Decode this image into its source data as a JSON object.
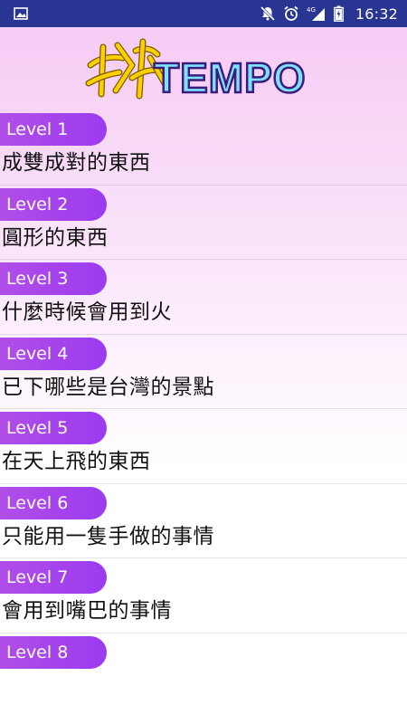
{
  "status_bar": {
    "time": "16:32",
    "network": "4G",
    "icons": [
      "image-icon",
      "mute-icon",
      "alarm-icon",
      "signal-icon",
      "battery-icon"
    ]
  },
  "header": {
    "logo_text": "TEMPO",
    "logo_colors": {
      "text_fill": "#7fe0ff",
      "text_stroke": "#3a1c7a",
      "prefix_fill": "#ffd000",
      "prefix_stroke": "#7a5b00"
    }
  },
  "levels": [
    {
      "label": "Level 1",
      "title": "成雙成對的東西"
    },
    {
      "label": "Level 2",
      "title": "圓形的東西"
    },
    {
      "label": "Level 3",
      "title": "什麼時候會用到火"
    },
    {
      "label": "Level 4",
      "title": "已下哪些是台灣的景點"
    },
    {
      "label": "Level 5",
      "title": "在天上飛的東西"
    },
    {
      "label": "Level 6",
      "title": "只能用一隻手做的事情"
    },
    {
      "label": "Level 7",
      "title": "會用到嘴巴的事情"
    },
    {
      "label": "Level 8",
      "title": ""
    }
  ],
  "theme": {
    "status_bar_bg": "#283593",
    "pill_gradient": [
      "#b14ee8",
      "#9b3bf0"
    ],
    "page_gradient_top": "#f6c8f4"
  }
}
